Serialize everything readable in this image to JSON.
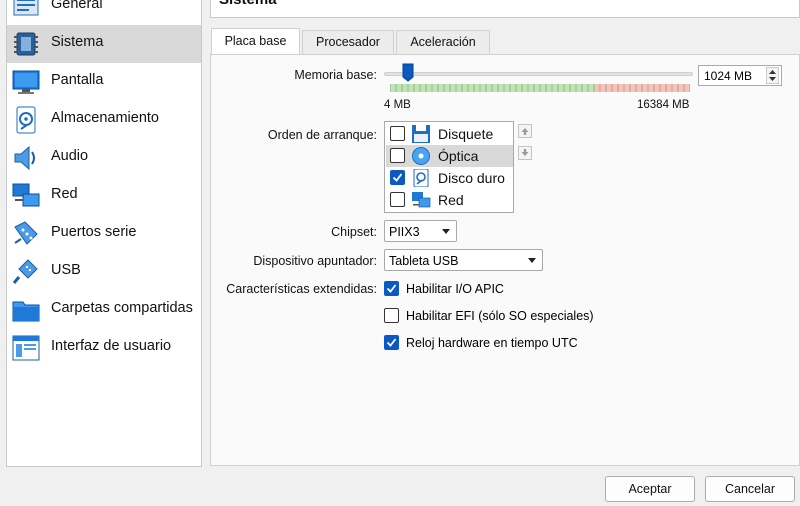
{
  "sidebar": {
    "items": [
      {
        "label": "General",
        "icon": "general-icon"
      },
      {
        "label": "Sistema",
        "icon": "chip-icon",
        "selected": true
      },
      {
        "label": "Pantalla",
        "icon": "monitor-icon"
      },
      {
        "label": "Almacenamiento",
        "icon": "disk-icon"
      },
      {
        "label": "Audio",
        "icon": "speaker-icon"
      },
      {
        "label": "Red",
        "icon": "network-icon"
      },
      {
        "label": "Puertos serie",
        "icon": "serial-port-icon"
      },
      {
        "label": "USB",
        "icon": "usb-icon"
      },
      {
        "label": "Carpetas compartidas",
        "icon": "folder-icon"
      },
      {
        "label": "Interfaz de usuario",
        "icon": "ui-window-icon"
      }
    ]
  },
  "header": {
    "title": "Sistema"
  },
  "tabs": [
    {
      "label": "Placa base",
      "active": true
    },
    {
      "label": "Procesador"
    },
    {
      "label": "Aceleración"
    }
  ],
  "motherboard": {
    "memory": {
      "label": "Memoria base:",
      "value_text": "1024 MB",
      "min_label": "4 MB",
      "max_label": "16384 MB"
    },
    "boot_order": {
      "label": "Orden de arranque:",
      "items": [
        {
          "label": "Disquete",
          "checked": false,
          "icon": "floppy-icon"
        },
        {
          "label": "Óptica",
          "checked": false,
          "icon": "optical-disc-icon",
          "highlighted": true
        },
        {
          "label": "Disco duro",
          "checked": true,
          "icon": "hard-disk-icon"
        },
        {
          "label": "Red",
          "checked": false,
          "icon": "network-icon"
        }
      ]
    },
    "chipset": {
      "label": "Chipset:",
      "value": "PIIX3"
    },
    "pointing_device": {
      "label": "Dispositivo apuntador:",
      "value": "Tableta USB"
    },
    "extended_features": {
      "label": "Características extendidas:",
      "options": [
        {
          "label": "Habilitar I/O APIC",
          "checked": true
        },
        {
          "label": "Habilitar EFI (sólo SO especiales)",
          "checked": false
        },
        {
          "label": "Reloj hardware en tiempo UTC",
          "checked": true
        }
      ]
    }
  },
  "buttons": {
    "ok": "Aceptar",
    "cancel": "Cancelar"
  },
  "colors": {
    "accent": "#0b5ac4",
    "selection": "#d9d9d9"
  }
}
